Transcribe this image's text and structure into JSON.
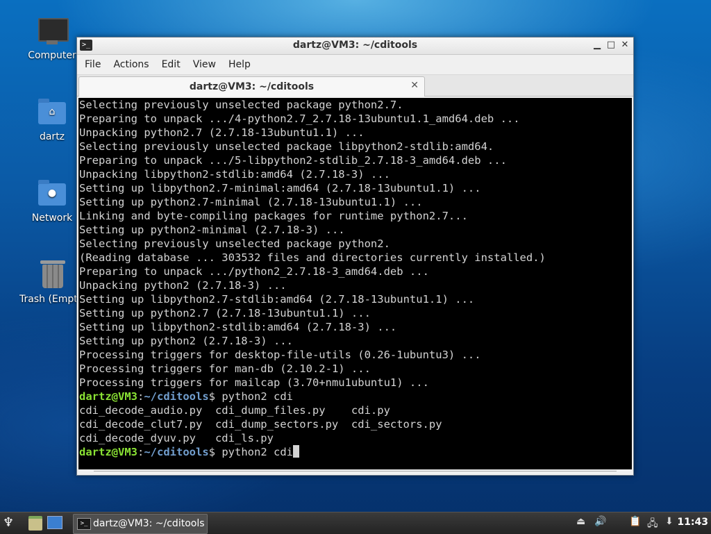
{
  "desktop": {
    "icons": [
      {
        "label": "Computer",
        "icon": "computer-icon"
      },
      {
        "label": "dartz",
        "icon": "home-folder-icon"
      },
      {
        "label": "Network",
        "icon": "network-folder-icon"
      },
      {
        "label": "Trash (Empt",
        "icon": "trash-icon"
      }
    ]
  },
  "window": {
    "title": "dartz@VM3: ~/cditools",
    "controls": {
      "minimize": "▁",
      "maximize": "□",
      "close": "✕"
    },
    "menu": [
      "File",
      "Actions",
      "Edit",
      "View",
      "Help"
    ],
    "tab": {
      "label": "dartz@VM3: ~/cditools",
      "close": "✕"
    }
  },
  "terminal": {
    "output_lines": [
      "Selecting previously unselected package python2.7.",
      "Preparing to unpack .../4-python2.7_2.7.18-13ubuntu1.1_amd64.deb ...",
      "Unpacking python2.7 (2.7.18-13ubuntu1.1) ...",
      "Selecting previously unselected package libpython2-stdlib:amd64.",
      "Preparing to unpack .../5-libpython2-stdlib_2.7.18-3_amd64.deb ...",
      "Unpacking libpython2-stdlib:amd64 (2.7.18-3) ...",
      "Setting up libpython2.7-minimal:amd64 (2.7.18-13ubuntu1.1) ...",
      "Setting up python2.7-minimal (2.7.18-13ubuntu1.1) ...",
      "Linking and byte-compiling packages for runtime python2.7...",
      "Setting up python2-minimal (2.7.18-3) ...",
      "Selecting previously unselected package python2.",
      "(Reading database ... 303532 files and directories currently installed.)",
      "Preparing to unpack .../python2_2.7.18-3_amd64.deb ...",
      "Unpacking python2 (2.7.18-3) ...",
      "Setting up libpython2.7-stdlib:amd64 (2.7.18-13ubuntu1.1) ...",
      "Setting up python2.7 (2.7.18-13ubuntu1.1) ...",
      "Setting up libpython2-stdlib:amd64 (2.7.18-3) ...",
      "Setting up python2 (2.7.18-3) ...",
      "Processing triggers for desktop-file-utils (0.26-1ubuntu3) ...",
      "Processing triggers for man-db (2.10.2-1) ...",
      "Processing triggers for mailcap (3.70+nmu1ubuntu1) ..."
    ],
    "prompt_user": "dartz@VM3",
    "prompt_sep": ":",
    "prompt_path": "~/cditools",
    "prompt_symbol": "$",
    "command_1": " python2 cdi",
    "completions": [
      [
        "cdi_decode_audio.py",
        "cdi_dump_files.py",
        "cdi.py"
      ],
      [
        "cdi_decode_clut7.py",
        "cdi_dump_sectors.py",
        "cdi_sectors.py"
      ],
      [
        "cdi_decode_dyuv.py",
        "cdi_ls.py",
        ""
      ]
    ],
    "command_2": " python2 cdi"
  },
  "taskbar": {
    "task_label": "dartz@VM3: ~/cditools",
    "clock": "11:43",
    "tray_icons": [
      "eject-icon",
      "volume-icon",
      "clipboard-icon",
      "network-icon",
      "updates-icon"
    ]
  }
}
